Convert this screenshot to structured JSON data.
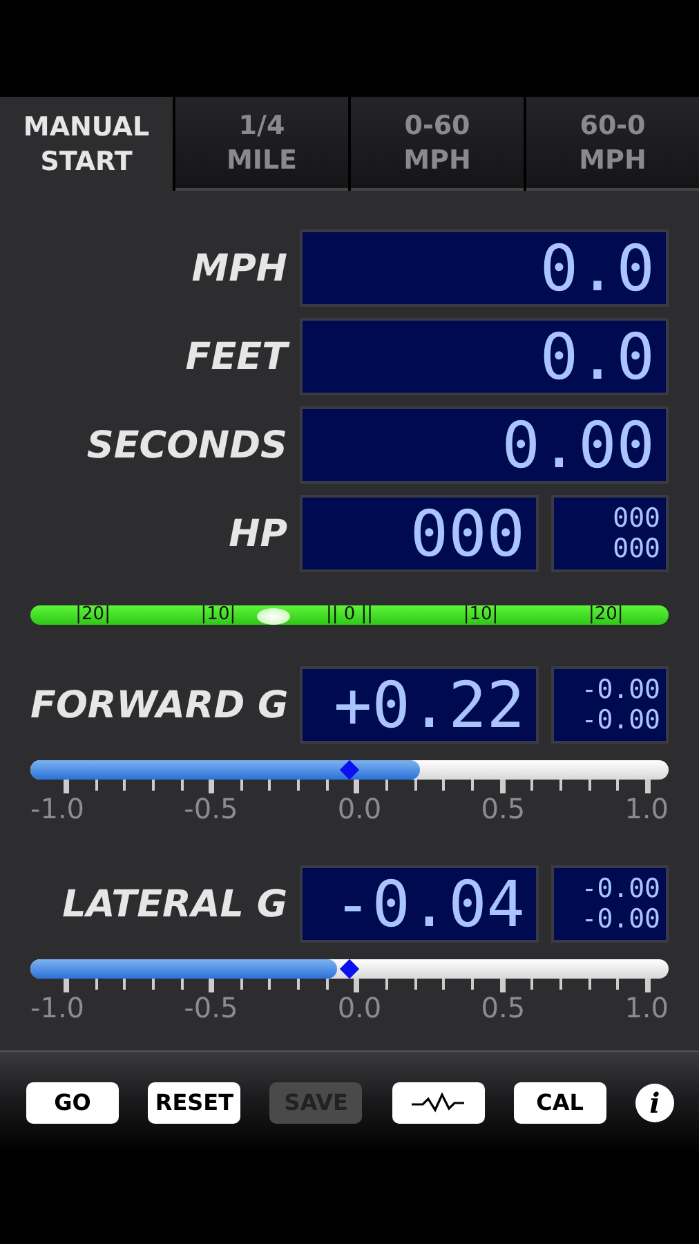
{
  "tabs": [
    {
      "lines": [
        "MANUAL",
        "START"
      ],
      "selected": true
    },
    {
      "lines": [
        "1/4",
        "MILE"
      ],
      "selected": false
    },
    {
      "lines": [
        "0-60",
        "MPH"
      ],
      "selected": false
    },
    {
      "lines": [
        "60-0",
        "MPH"
      ],
      "selected": false
    }
  ],
  "readouts": [
    {
      "label": "MPH",
      "value": "0.0"
    },
    {
      "label": "FEET",
      "value": "0.0"
    },
    {
      "label": "SECONDS",
      "value": "0.00"
    },
    {
      "label": "HP",
      "value": "000",
      "side": [
        "000",
        "000"
      ]
    }
  ],
  "level_bar": {
    "scale": [
      "|20|",
      "|10|",
      "|| 0 ||",
      "|10|",
      "|20|"
    ],
    "level": 0.38
  },
  "gauges": [
    {
      "label": "FORWARD G",
      "value": "+0.22",
      "side": [
        "-0.00",
        "-0.00"
      ],
      "level": 0.61,
      "scale": [
        "-1.0",
        "-0.5",
        "0.0",
        "0.5",
        "1.0"
      ]
    },
    {
      "label": "LATERAL G",
      "value": "-0.04",
      "side": [
        "-0.00",
        "-0.00"
      ],
      "level": 0.48,
      "scale": [
        "-1.0",
        "-0.5",
        "0.0",
        "0.5",
        "1.0"
      ]
    }
  ],
  "toolbar": [
    {
      "kind": "text",
      "label": "GO",
      "disabled": false
    },
    {
      "kind": "text",
      "label": "RESET",
      "disabled": false
    },
    {
      "kind": "text",
      "label": "SAVE",
      "disabled": true
    },
    {
      "kind": "graph",
      "disabled": false
    },
    {
      "kind": "text",
      "label": "CAL",
      "disabled": false
    },
    {
      "kind": "info",
      "label": "i",
      "disabled": false
    }
  ]
}
